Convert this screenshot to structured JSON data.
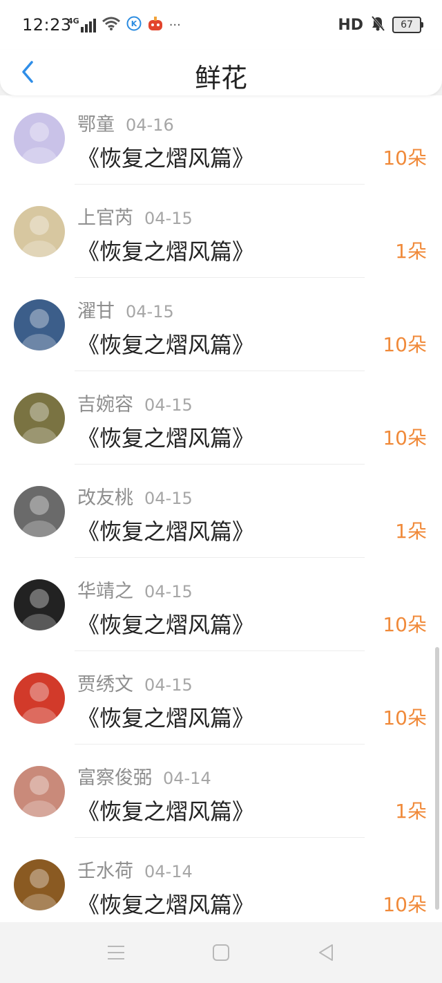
{
  "status_bar": {
    "time": "12:23",
    "network": "4G",
    "hd": "HD",
    "battery": "67",
    "more": "···"
  },
  "header": {
    "title": "鲜花"
  },
  "items": [
    {
      "name": "鄂童",
      "date": "04-16",
      "book": "《恢复之熠风篇》",
      "flowers": "10朵",
      "avatar_color": "#c9c2e8"
    },
    {
      "name": "上官芮",
      "date": "04-15",
      "book": "《恢复之熠风篇》",
      "flowers": "1朵",
      "avatar_color": "#d7c7a0"
    },
    {
      "name": "濯甘",
      "date": "04-15",
      "book": "《恢复之熠风篇》",
      "flowers": "10朵",
      "avatar_color": "#3c5e8a"
    },
    {
      "name": "吉婉容",
      "date": "04-15",
      "book": "《恢复之熠风篇》",
      "flowers": "10朵",
      "avatar_color": "#7a7342"
    },
    {
      "name": "改友桃",
      "date": "04-15",
      "book": "《恢复之熠风篇》",
      "flowers": "1朵",
      "avatar_color": "#6a6a6a"
    },
    {
      "name": "华靖之",
      "date": "04-15",
      "book": "《恢复之熠风篇》",
      "flowers": "10朵",
      "avatar_color": "#222222"
    },
    {
      "name": "贾绣文",
      "date": "04-15",
      "book": "《恢复之熠风篇》",
      "flowers": "10朵",
      "avatar_color": "#d23a2a"
    },
    {
      "name": "富察俊弼",
      "date": "04-14",
      "book": "《恢复之熠风篇》",
      "flowers": "1朵",
      "avatar_color": "#c98a7a"
    },
    {
      "name": "壬水荷",
      "date": "04-14",
      "book": "《恢复之熠风篇》",
      "flowers": "10朵",
      "avatar_color": "#8a5a22"
    }
  ],
  "colors": {
    "accent": "#2f8ee8",
    "flowers": "#f08a3a"
  }
}
